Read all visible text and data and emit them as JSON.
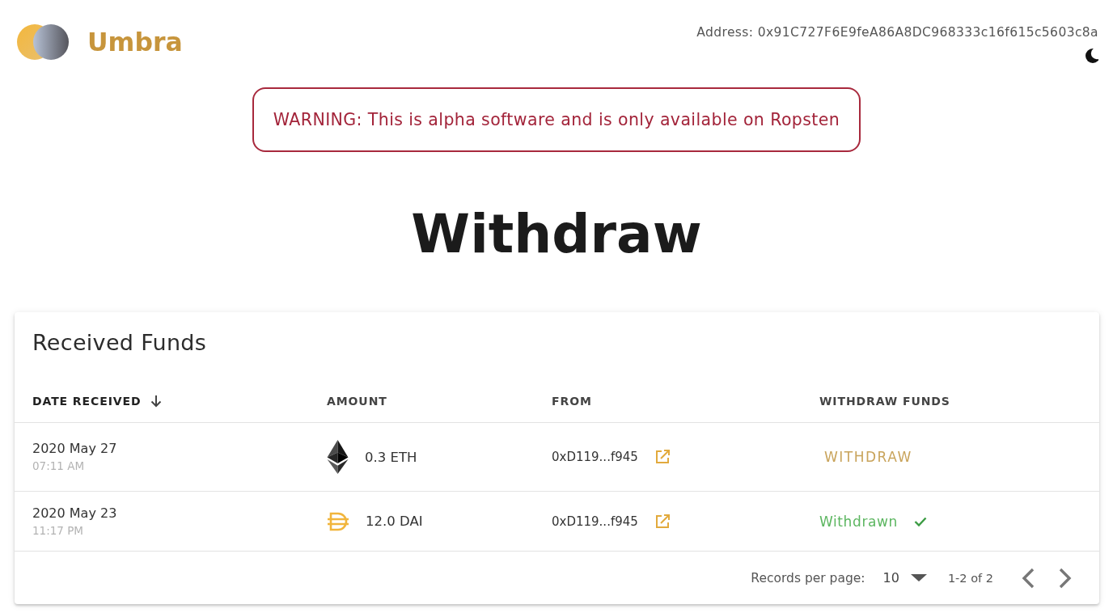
{
  "header": {
    "app_name": "Umbra",
    "address": "Address: 0x91C727F6E9feA86A8DC968333c16f615c5603c8a"
  },
  "warning": "WARNING: This is alpha software and is only available on Ropsten",
  "page_title": "Withdraw",
  "received_funds": {
    "title": "Received Funds",
    "columns": [
      {
        "label": "DATE RECEIVED",
        "sorted": true
      },
      {
        "label": "AMOUNT",
        "sorted": false
      },
      {
        "label": "FROM",
        "sorted": false
      },
      {
        "label": "WITHDRAW FUNDS",
        "sorted": false
      }
    ],
    "rows": [
      {
        "date": "2020 May 27",
        "time": "07:11 AM",
        "amount": {
          "kind": "eth",
          "text": "0.3 ETH"
        },
        "from": "0xD119...f945",
        "status": {
          "kind": "action",
          "label": "WITHDRAW"
        }
      },
      {
        "date": "2020 May 23",
        "time": "11:17 PM",
        "amount": {
          "kind": "dai",
          "text": "12.0 DAI"
        },
        "from": "0xD119...f945",
        "status": {
          "kind": "done",
          "label": "Withdrawn"
        }
      }
    ],
    "pagination": {
      "records_label": "Records per page:",
      "per_page": "10",
      "range": "1-2 of 2"
    }
  }
}
